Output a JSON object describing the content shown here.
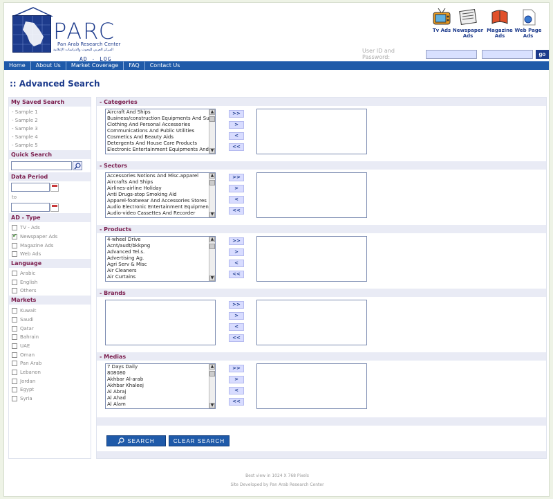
{
  "header": {
    "logo_word": "PARC",
    "logo_subtitle": "Pan Arab Research Center",
    "logo_arabic": "المركز العربي للبحوث والدراسات الإعلانية",
    "product_name": "AD - LOG",
    "ad_types": [
      {
        "label": "Tv Ads",
        "icon": "tv-icon"
      },
      {
        "label": "Newspaper Ads",
        "icon": "newspaper-icon"
      },
      {
        "label": "Magazine Ads",
        "icon": "magazine-icon"
      },
      {
        "label": "Web Page Ads",
        "icon": "web-page-icon"
      }
    ],
    "login_label": "User ID and Password:",
    "go_label": "go"
  },
  "nav": [
    "Home",
    "About Us",
    "Market Coverage",
    "FAQ",
    "Contact Us"
  ],
  "page_title": ":: Advanced Search",
  "sidebar": {
    "saved_title": "My Saved Search",
    "saved": [
      "- Sample 1",
      "- Sample 2",
      "- Sample 3",
      "- Sample 4",
      "- Sample 5"
    ],
    "quick_title": "Quick Search",
    "period_title": "Data Period",
    "period_to": "to",
    "adtype_title": "AD - Type",
    "adtypes": [
      {
        "label": "TV - Ads",
        "checked": false
      },
      {
        "label": "Newspaper Ads",
        "checked": true
      },
      {
        "label": "Magazine Ads",
        "checked": false
      },
      {
        "label": "Web Ads",
        "checked": false
      }
    ],
    "language_title": "Language",
    "languages": [
      "Arabic",
      "English",
      "Others"
    ],
    "markets_title": "Markets",
    "markets": [
      "Kuwait",
      "Saudi",
      "Qatar",
      "Bahrain",
      "UAE",
      "Oman",
      "Pan Arab",
      "Lebanon",
      "Jordan",
      "Egypt",
      "Syria"
    ]
  },
  "sections": [
    {
      "title": "- Categories",
      "items": [
        "Aircraft And Ships",
        "Business/construction Equipments And Supply",
        "Clothing And Personal Accessories",
        "Communications And Public Utilities",
        "Cosmetics And Beauty Aids",
        "Detergents And House Care Products",
        "Electronic Entertainment Equipments And Supp"
      ]
    },
    {
      "title": "- Sectors",
      "items": [
        "Accessories Notions And Misc.apparel",
        "Aircrafts And Ships",
        "Airlines-airline Holiday",
        "Anti Drugs-stop Smoking Aid",
        "Apparel-footwear And Accessories Stores",
        "Audio Electronic Entertainment Equipments-mp3",
        "Audio-video Cassettes And Recorder"
      ]
    },
    {
      "title": "- Products",
      "items": [
        "4-wheel Drive",
        "Acnt/audt/bkkpng",
        "Advanced Tel.s.",
        "Advertising Ag.",
        "Agri Serv & Misc",
        "Air Cleaners",
        "Air Curtains"
      ]
    },
    {
      "title": "- Brands",
      "items": []
    },
    {
      "title": "- Medias",
      "items": [
        "7 Days Daily",
        "808080",
        "Akhbar Al-arab",
        "Akhbar Khaleej",
        "Al Abraj",
        "Al Ahad",
        "Al Alam"
      ]
    }
  ],
  "move_buttons": [
    ">>",
    ">",
    "<",
    "<<"
  ],
  "actions": {
    "search": "SEARCH",
    "clear": "CLEAR SEARCH"
  },
  "footer": {
    "line1": "Best view in 1024 X 768 Pixels",
    "line2": "Site Developed by Pan Arab Research Center"
  }
}
